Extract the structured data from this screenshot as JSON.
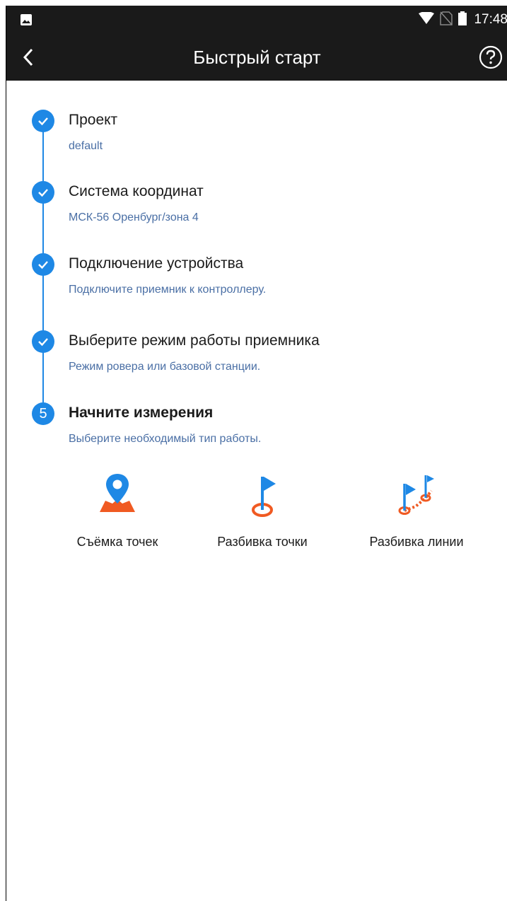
{
  "status_bar": {
    "time": "17:48",
    "icons": [
      "image-notification-icon",
      "wifi-icon",
      "no-sim-icon",
      "battery-icon"
    ]
  },
  "app_bar": {
    "title": "Быстрый старт",
    "back_icon": "back-arrow-icon",
    "help_icon": "help-circle-icon"
  },
  "steps": [
    {
      "state": "done",
      "title": "Проект",
      "subtitle": "default"
    },
    {
      "state": "done",
      "title": "Система координат",
      "subtitle": "МСК-56 Оренбург/зона 4"
    },
    {
      "state": "done",
      "title": "Подключение устройства",
      "subtitle": "Подключите приемник к контроллеру."
    },
    {
      "state": "done",
      "title": "Выберите режим работы приемника",
      "subtitle": "Режим ровера или базовой станции."
    },
    {
      "state": "current",
      "number": "5",
      "title": "Начните измерения",
      "subtitle": "Выберите необходимый тип работы."
    }
  ],
  "actions": [
    {
      "label": "Съёмка точек",
      "icon": "point-survey-icon"
    },
    {
      "label": "Разбивка точки",
      "icon": "point-stakeout-icon"
    },
    {
      "label": "Разбивка линии",
      "icon": "line-stakeout-icon"
    }
  ],
  "colors": {
    "bar_background": "#1a1a1a",
    "accent_blue": "#1e88e5",
    "icon_orange": "#f05a22",
    "subtitle_text": "#4a6fa5"
  }
}
